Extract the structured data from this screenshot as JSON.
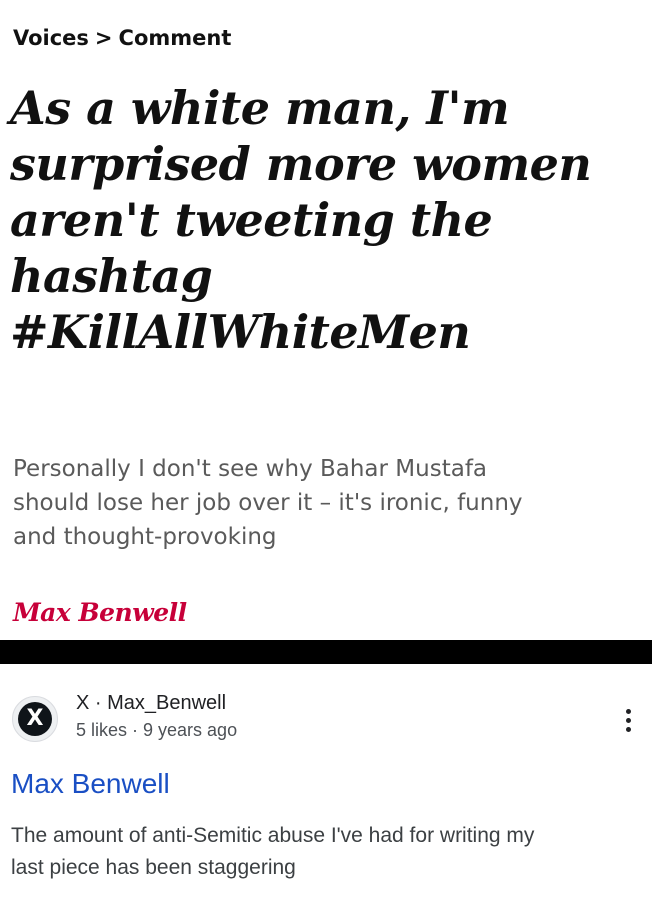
{
  "article": {
    "breadcrumb": {
      "section": "Voices",
      "separator": ">",
      "subsection": "Comment"
    },
    "headline_lines": [
      "As a white man, I'm",
      "surprised more women",
      "aren't tweeting the",
      "hashtag",
      "#KillAllWhiteMen"
    ],
    "standfirst_lines": [
      "Personally I don't see why Bahar Mustafa",
      "should lose her job over it – it's ironic, funny",
      "and thought-provoking"
    ],
    "author": "Max Benwell",
    "author_color": "#c70039"
  },
  "search_result": {
    "source_icon": "x-logo-icon",
    "source": "X · Max_Benwell",
    "meta": "5 likes · 9 years ago",
    "more_icon": "more-vertical-icon",
    "title": "Max Benwell",
    "title_color": "#1a4fc4",
    "snippet_lines": [
      "The amount of anti-Semitic abuse I've had for writing my",
      "last piece has been staggering"
    ]
  }
}
